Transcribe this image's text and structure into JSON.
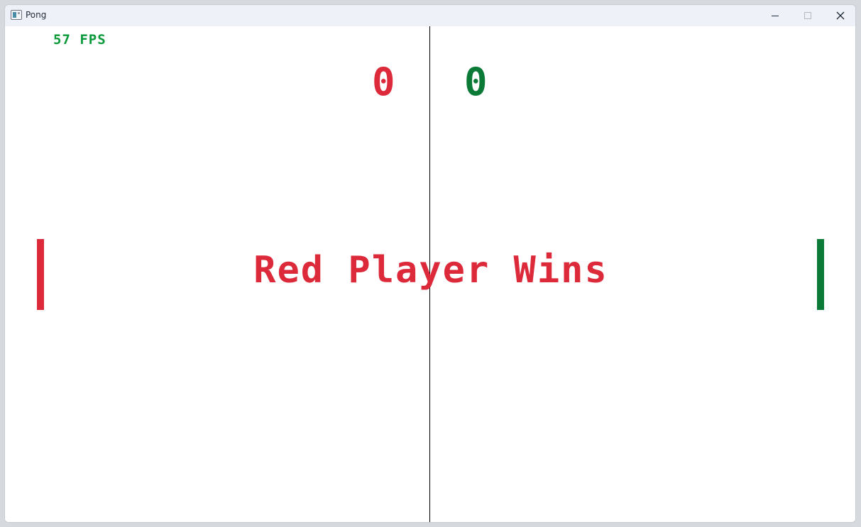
{
  "window": {
    "title": "Pong",
    "icon": "app-window-icon",
    "controls": {
      "minimize": "minimize-icon",
      "maximize": "maximize-icon",
      "close": "close-icon"
    }
  },
  "game": {
    "fps_text": "57 FPS",
    "scores": {
      "red": "0",
      "green": "0"
    },
    "message": "Red Player Wins"
  },
  "colors": {
    "red": "#dc2a3a",
    "green": "#0b7a37",
    "fps": "#0a9a3a",
    "net": "#000000",
    "background": "#ffffff"
  }
}
